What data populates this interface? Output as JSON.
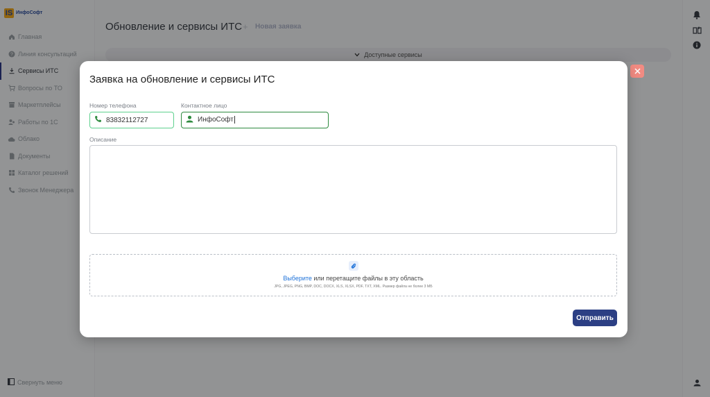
{
  "brand": {
    "mark": "IS",
    "name": "ИнфоСофт"
  },
  "sidebar": {
    "items": [
      {
        "label": "Главная",
        "icon": "home-icon"
      },
      {
        "label": "Линия консультаций",
        "icon": "help-icon"
      },
      {
        "label": "Сервисы ИТС",
        "icon": "download-icon",
        "active": true
      },
      {
        "label": "Вопросы по ТО",
        "icon": "cart-icon"
      },
      {
        "label": "Маркетплейсы",
        "icon": "store-icon"
      },
      {
        "label": "Работы по 1С",
        "icon": "people-icon"
      },
      {
        "label": "Облако",
        "icon": "cloud-icon"
      },
      {
        "label": "Документы",
        "icon": "document-icon"
      },
      {
        "label": "Каталог решений",
        "icon": "grid-icon"
      },
      {
        "label": "Звонок Менеджера",
        "icon": "phone-icon"
      }
    ],
    "collapse_label": "Свернуть меню"
  },
  "header": {
    "title": "Обновление и сервисы ИТС",
    "separator": "+",
    "crumb": "Новая заявка"
  },
  "services_bar": {
    "label": "Доступные сервисы"
  },
  "modal": {
    "title": "Заявка на обновление и сервисы ИТС",
    "phone": {
      "label": "Номер телефона",
      "value": "83832112727"
    },
    "contact": {
      "label": "Контактное лицо",
      "value": "ИнфоСофт"
    },
    "description": {
      "label": "Описание",
      "value": ""
    },
    "upload": {
      "link": "Выберите",
      "text": " или перетащите файлы в эту область",
      "hint": "JPG, JPEG, PNG, BMP, DOC, DOCX, XLS, XLSX, PDF, TXT, XML. Размер файла не более 3 МБ"
    },
    "submit_label": "Отправить"
  },
  "colors": {
    "accent": "#2c3f84",
    "phone_border": "#5dd08d",
    "contact_border": "#2d8a3e",
    "close": "#f28b82",
    "link": "#1e72d9"
  }
}
